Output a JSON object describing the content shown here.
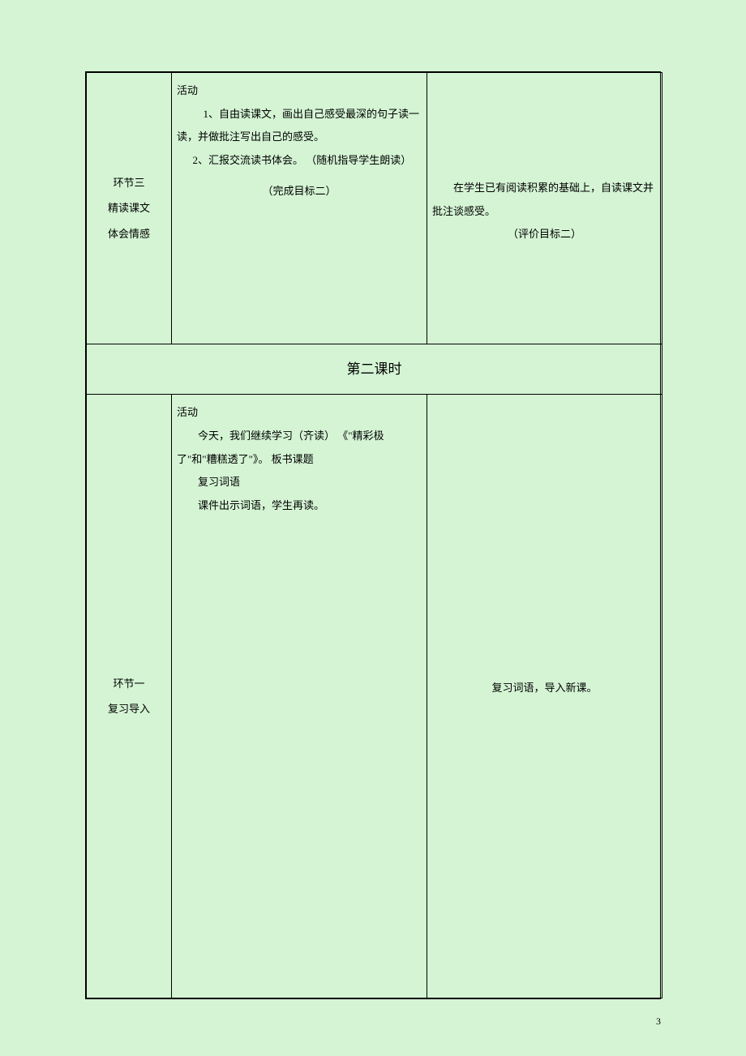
{
  "row1": {
    "col1": {
      "line1": "环节三",
      "line2": "精读课文",
      "line3": "体会情感"
    },
    "col2": {
      "heading": "活动",
      "item1": "1、自由读课文，画出自己感受最深的句子读一读，并做批注写出自己的感受。",
      "item2": "2、汇报交流读书体会。 （随机指导学生朗读）",
      "goal": "（完成目标二）"
    },
    "col3": {
      "line1": "在学生已有阅读积累的基础上，自读课文并批注谈感受。",
      "line2": "（评价目标二）"
    }
  },
  "section_header": "第二课时",
  "row2": {
    "col1": {
      "line1": "环节一",
      "line2": "复习导入"
    },
    "col2": {
      "heading": "活动",
      "line1": "今天，我们继续学习（齐读） 《\"精彩极了\"和\"糟糕透了\"》。   板书课题",
      "line2": "复习词语",
      "line3": "课件出示词语，学生再读。"
    },
    "col3": {
      "line1": "复习词语，导入新课。"
    }
  },
  "page_number": "3"
}
